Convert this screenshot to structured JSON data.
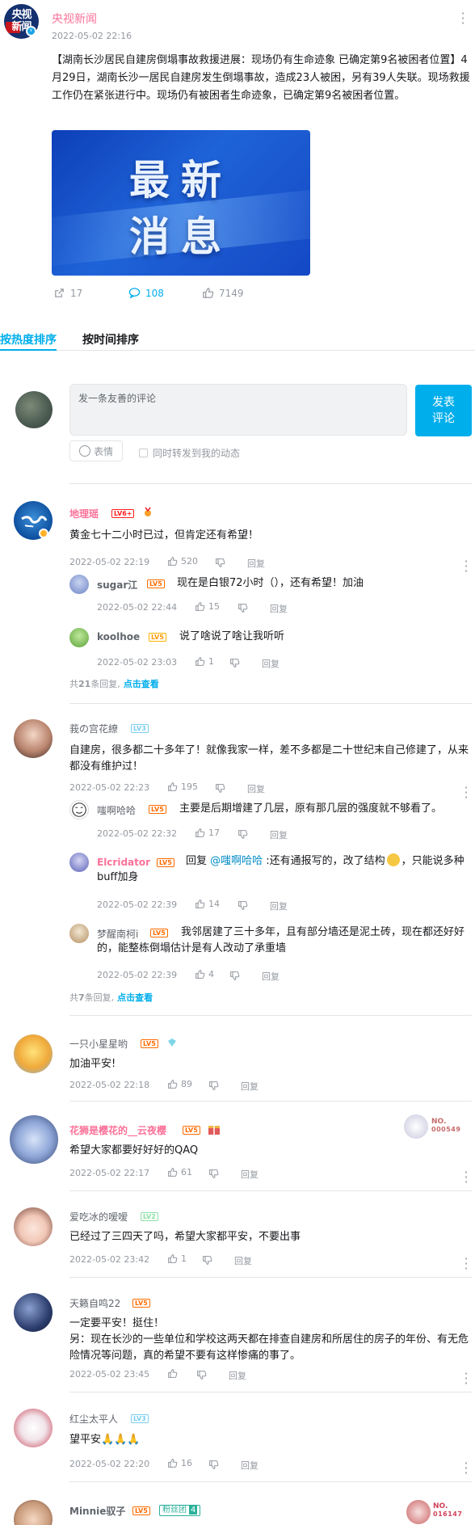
{
  "post": {
    "author": "央视新闻",
    "avatar_text_top": "央视",
    "avatar_text_bottom": "新闻",
    "time": "2022-05-02 22:16",
    "text": "【湖南长沙居民自建房倒塌事故救援进展：现场仍有生命迹象 已确定第9名被困者位置】4月29日，湖南长沙一居民自建房发生倒塌事故，造成23人被困，另有39人失联。现场救援工作仍在紧张进行中。现场仍有被困者生命迹象，已确定第9名被困者位置。",
    "image_text_line1": "最新",
    "image_text_line2": "消息",
    "stats": {
      "forward": "17",
      "comment": "108",
      "like": "7149"
    }
  },
  "tabs": {
    "hot": "按热度排序",
    "time": "按时间排序"
  },
  "composer": {
    "placeholder": "发一条友善的评论",
    "send_line1": "发表",
    "send_line2": "评论",
    "emoji_label": "表情",
    "sync_label": "同时转发到我的动态"
  },
  "labels": {
    "reply": "回复",
    "view_all": "点击查看",
    "more_prefix": "共",
    "more_suffix": "条回复,"
  },
  "comments": [
    {
      "name": "地理瑶",
      "level": "LV6+",
      "text": "黄金七十二小时已过，但肯定还有希望！",
      "time": "2022-05-02 22:19",
      "likes": "520",
      "reply_count": "21",
      "replies": [
        {
          "name": "sugar江",
          "level": "LV5",
          "text": "现在是白银72小时（），还有希望！加油",
          "time": "2022-05-02 22:44",
          "likes": "15"
        },
        {
          "name": "koolhoe",
          "level": "LV5",
          "text": "说了啥说了啥让我听听",
          "time": "2022-05-02 23:03",
          "likes": "1"
        }
      ]
    },
    {
      "name": "莪の宫花繚",
      "level": "LV3",
      "text": "自建房，很多都二十多年了！就像我家一样，差不多都是二十世纪末自己修建了，从来都没有维护过！",
      "time": "2022-05-02 22:23",
      "likes": "195",
      "reply_count": "7",
      "replies": [
        {
          "name": "嗤啊哈哈",
          "level": "LV5",
          "text": "主要是后期增建了几层，原有那几层的强度就不够看了。",
          "time": "2022-05-02 22:32",
          "likes": "17"
        },
        {
          "name": "Elcridator",
          "level": "LV5",
          "reply_prefix": "回复 ",
          "mention": "@嗤啊哈哈",
          "text": " :还有通报写的，改了结构",
          "text2": "，只能说多种buff加身",
          "time": "2022-05-02 22:39",
          "likes": "14"
        },
        {
          "name": "梦醒南柯i",
          "level": "LV5",
          "text": "我邻居建了三十多年，且有部分墙还是泥土砖，现在都还好好的，能整栋倒塌估计是有人改动了承重墙",
          "time": "2022-05-02 22:39",
          "likes": "4"
        }
      ]
    },
    {
      "name": "一只小星星哟",
      "level": "LV5",
      "text": "加油平安!",
      "time": "2022-05-02 22:18",
      "likes": "89"
    },
    {
      "name": "花狮是樱花的__云夜樱",
      "level": "LV5",
      "text": "希望大家都要好好好的QAQ",
      "time": "2022-05-02 22:17",
      "likes": "61",
      "badge_no": "NO.",
      "badge_num": "000549"
    },
    {
      "name": "爱吃冰的嗳嗳",
      "level": "LV2",
      "text": "已经过了三四天了吗，希望大家都平安，不要出事",
      "time": "2022-05-02 23:42",
      "likes": "1"
    },
    {
      "name": "天籁自鸣22",
      "level": "LV5",
      "text": "一定要平安！挺住！\n另：现在长沙的一些单位和学校这两天都在排查自建房和所居住的房子的年份、有无危险情况等问题，真的希望不要有这样惨痛的事了。",
      "time": "2022-05-02 23:45",
      "likes": ""
    },
    {
      "name": "红尘太平人",
      "level": "LV3",
      "text": "望平安🙏🙏🙏",
      "time": "2022-05-02 22:20",
      "likes": "16"
    },
    {
      "name": "Minnie驭子",
      "level": "LV5",
      "fan_label": "粉丝团",
      "fan_level": "4",
      "badge_no": "NO.",
      "badge_num": "016147"
    }
  ]
}
